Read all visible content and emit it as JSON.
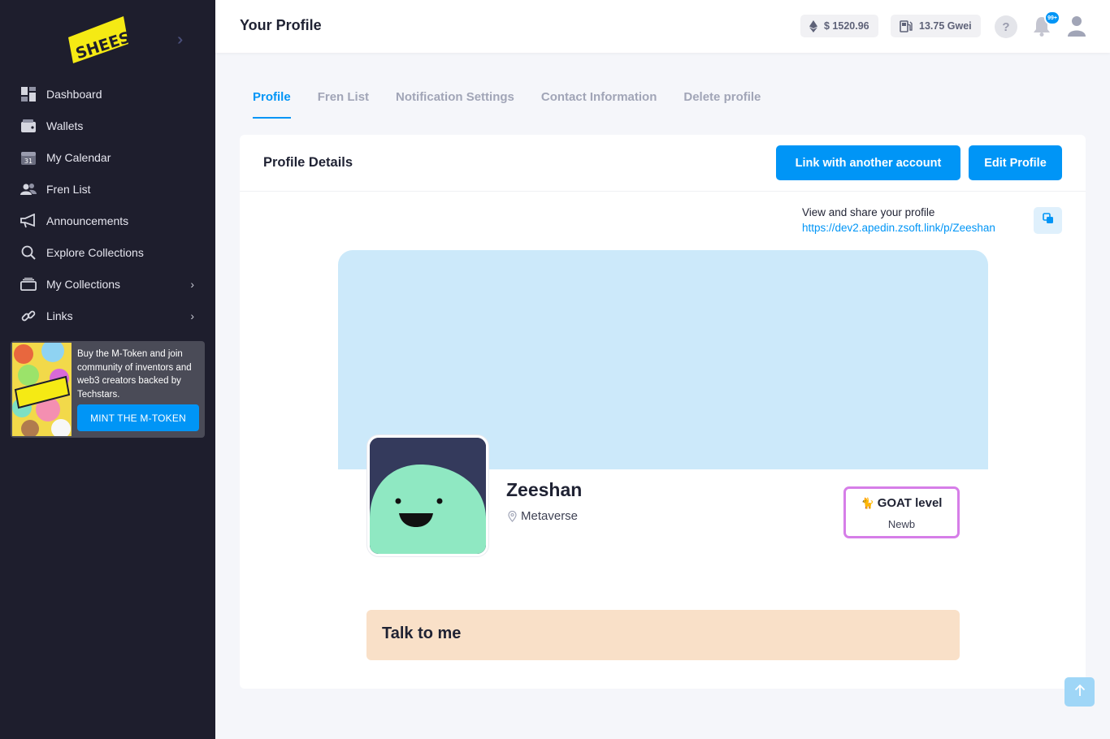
{
  "sidebar": {
    "logo_text": "SHEESH",
    "items": [
      {
        "label": "Dashboard",
        "icon": "dashboard-icon"
      },
      {
        "label": "Wallets",
        "icon": "wallet-icon"
      },
      {
        "label": "My Calendar",
        "icon": "calendar-icon",
        "icon_text": "31"
      },
      {
        "label": "Fren List",
        "icon": "users-icon"
      },
      {
        "label": "Announcements",
        "icon": "megaphone-icon"
      },
      {
        "label": "Explore Collections",
        "icon": "search-icon"
      },
      {
        "label": "My Collections",
        "icon": "collection-icon",
        "has_submenu": true
      },
      {
        "label": "Links",
        "icon": "link-icon",
        "has_submenu": true
      }
    ],
    "promo": {
      "text": "Buy the M-Token and join community of inventors and web3 creators backed by Techstars.",
      "button": "MINT THE M-TOKEN"
    }
  },
  "header": {
    "title": "Your Profile",
    "eth_price": "$ 1520.96",
    "gas": "13.75 Gwei",
    "help": "?",
    "notification_badge": "99+"
  },
  "tabs": [
    {
      "label": "Profile",
      "active": true
    },
    {
      "label": "Fren List",
      "active": false
    },
    {
      "label": "Notification Settings",
      "active": false
    },
    {
      "label": "Contact Information",
      "active": false
    },
    {
      "label": "Delete profile",
      "active": false
    }
  ],
  "card": {
    "title": "Profile Details",
    "link_button": "Link with another account",
    "edit_button": "Edit Profile",
    "share_label": "View and share your profile",
    "share_url": "https://dev2.apedin.zsoft.link/p/Zeeshan"
  },
  "profile": {
    "name": "Zeeshan",
    "location": "Metaverse",
    "goat_level_title": "GOAT level",
    "goat_emoji": "🐈",
    "goat_level_value": "Newb",
    "talk_title": "Talk to me"
  },
  "colors": {
    "sidebar_bg": "#1e1e2d",
    "accent": "#0095f6",
    "cover": "#cce9fa",
    "talk_bg": "#f9e0c8",
    "goat_border": "#d67ee8",
    "avatar_bg": "#343a5c",
    "avatar_blob": "#8fe8c2"
  }
}
